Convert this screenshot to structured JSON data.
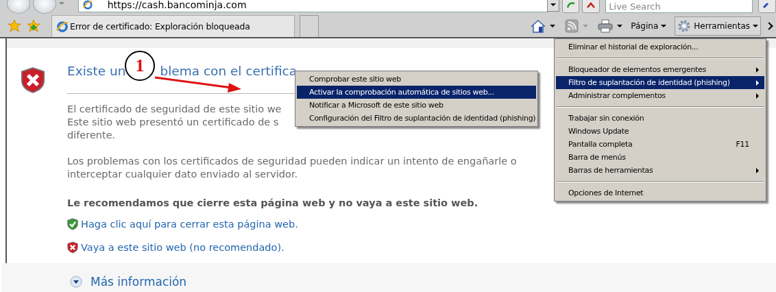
{
  "address_bar": {
    "url": "https://cash.bancominja.com"
  },
  "search": {
    "placeholder": "Live Search"
  },
  "tabs": [
    {
      "title": "Error de certificado: Exploración bloqueada"
    }
  ],
  "command_bar": [
    {
      "kind": "home"
    },
    {
      "kind": "feed"
    },
    {
      "kind": "print"
    },
    {
      "kind": "page",
      "label": "Página",
      "selected": false
    },
    {
      "kind": "tools",
      "label": "Herramientas",
      "selected": true
    }
  ],
  "page": {
    "heading_parts": [
      "Existe un",
      "blema con el certifica"
    ],
    "paragraphs": [
      [
        "El certificado de seguridad de este sitio we",
        "Este sitio web presentó un certificado de s",
        "diferente."
      ],
      [
        "Los problemas con los certificados de seguridad pueden indicar un intento de engañarle o",
        "interceptar cualquier dato enviado al servidor."
      ]
    ],
    "recommendation": "Le recomendamos que cierre esta página web y no vaya a este sitio web.",
    "links": [
      {
        "kind": "safe",
        "text": "Haga clic aquí para cerrar esta página web."
      },
      {
        "kind": "unsafe",
        "text": "Vaya a este sitio web (no recomendado)."
      }
    ],
    "more_info": "Más información"
  },
  "annotation": {
    "number": "1"
  },
  "tools_menu": [
    {
      "kind": "item",
      "label": "Eliminar el historial de exploración...",
      "submenu": false,
      "selected": false
    },
    {
      "kind": "separator"
    },
    {
      "kind": "item",
      "label": "Bloqueador de elementos emergentes",
      "submenu": true,
      "selected": false
    },
    {
      "kind": "item",
      "label": "Filtro de suplantación de identidad (phishing)",
      "submenu": true,
      "selected": true
    },
    {
      "kind": "item",
      "label": "Administrar complementos",
      "submenu": true,
      "selected": false
    },
    {
      "kind": "separator"
    },
    {
      "kind": "item",
      "label": "Trabajar sin conexión",
      "submenu": false,
      "selected": false
    },
    {
      "kind": "item",
      "label": "Windows Update",
      "submenu": false,
      "selected": false
    },
    {
      "kind": "item",
      "label": "Pantalla completa",
      "shortcut": "F11",
      "submenu": false,
      "selected": false
    },
    {
      "kind": "item",
      "label": "Barra de menús",
      "submenu": false,
      "selected": false
    },
    {
      "kind": "item",
      "label": "Barras de herramientas",
      "submenu": true,
      "selected": false
    },
    {
      "kind": "separator"
    },
    {
      "kind": "item",
      "label": "Opciones de Internet",
      "submenu": false,
      "selected": false
    }
  ],
  "phishing_submenu": [
    {
      "kind": "item",
      "label": "Comprobar este sitio web",
      "submenu": false,
      "selected": false
    },
    {
      "kind": "item",
      "label": "Activar la comprobación automática de sitios web...",
      "submenu": false,
      "selected": true
    },
    {
      "kind": "item",
      "label": "Notificar a Microsoft de este sitio web",
      "submenu": false,
      "selected": false
    },
    {
      "kind": "item",
      "label": "Configuración del Filtro de suplantación de identidad (phishing)",
      "submenu": false,
      "selected": false
    }
  ]
}
